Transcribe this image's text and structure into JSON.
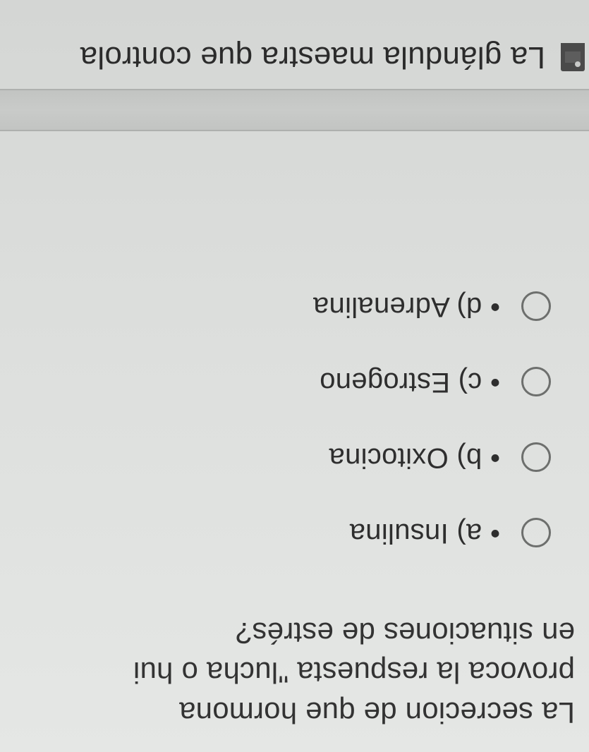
{
  "question": {
    "line1": "La secrecion de que hormona",
    "line2": "provoca la respuesta \"lucha o hui",
    "line3": "en situaciones de estrés?"
  },
  "options": [
    {
      "label": "• a) Insulina"
    },
    {
      "label": "• b) Oxitocina"
    },
    {
      "label": "• c) Estrogeno"
    },
    {
      "label": "• d) Adrenalina"
    }
  ],
  "next_question": {
    "text": "La glándula maestra que controla"
  }
}
